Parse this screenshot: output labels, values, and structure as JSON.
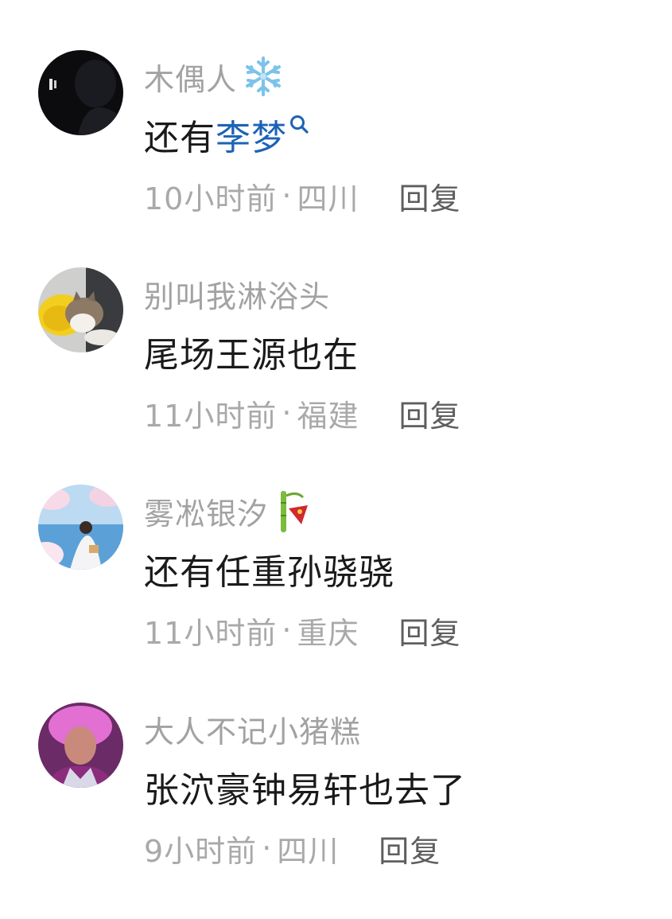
{
  "comments": [
    {
      "username": "木偶人",
      "text": "还有",
      "link_text": "李梦",
      "time": "10小时前",
      "location": "四川",
      "reply_label": "回复",
      "badge_icon": "snowflake-icon"
    },
    {
      "username": "别叫我淋浴头",
      "text": "尾场王源也在",
      "time": "11小时前",
      "location": "福建",
      "reply_label": "回复"
    },
    {
      "username": "雾凇银汐",
      "text": "还有任重孙骁骁",
      "time": "11小时前",
      "location": "重庆",
      "reply_label": "回复",
      "badge_icon": "bamboo-icon"
    },
    {
      "username": "大人不记小猪糕",
      "text": "张泬豪钟易轩也去了",
      "time": "9小时前",
      "location": "四川",
      "reply_label": "回复"
    }
  ],
  "meta_separator": "·",
  "colors": {
    "username": "#a2a2a2",
    "text": "#1a1a1a",
    "link": "#1c63b5",
    "meta": "#a9a9a9",
    "reply": "#5e5e5e"
  }
}
